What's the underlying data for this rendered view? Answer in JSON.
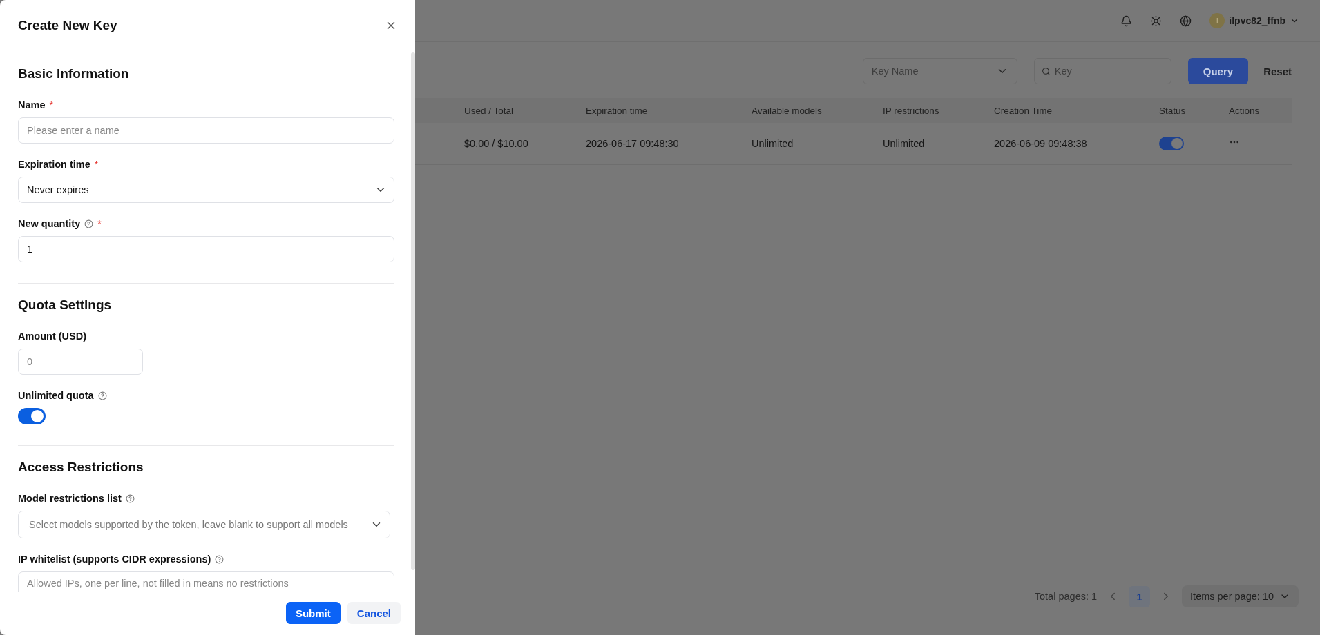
{
  "drawer": {
    "title": "Create New Key",
    "sections": [
      {
        "title": "Basic Information",
        "fields": [
          {
            "kind": "text",
            "label": "Name",
            "required_mark": "*",
            "placeholder": "Please enter a name"
          },
          {
            "kind": "select",
            "label": "Expiration time",
            "required_mark": "*",
            "value": "Never expires"
          },
          {
            "kind": "text",
            "label": "New quantity",
            "required_mark": "*",
            "help": true,
            "value": "1"
          }
        ]
      },
      {
        "title": "Quota Settings",
        "fields": [
          {
            "kind": "number",
            "label": "Amount (USD)",
            "placeholder": "0"
          },
          {
            "kind": "switch",
            "label": "Unlimited quota",
            "help": true,
            "on": true
          }
        ]
      },
      {
        "title": "Access Restrictions",
        "fields": [
          {
            "kind": "select",
            "label": "Model restrictions list",
            "help": true,
            "placeholder": "Select models supported by the token, leave blank to support all models"
          },
          {
            "kind": "textarea",
            "label": "IP whitelist (supports CIDR expressions)",
            "help": true,
            "placeholder": "Allowed IPs, one per line, not filled in means no restrictions"
          }
        ]
      }
    ],
    "buttons": [
      {
        "label": "Submit",
        "kind": "primary"
      },
      {
        "label": "Cancel",
        "kind": "secondary"
      }
    ]
  },
  "topbar": {
    "avatar_initial": "I",
    "username": "ilpvc82_ffnb"
  },
  "filters": {
    "select_placeholder": "Key Name",
    "search_placeholder": "Key",
    "buttons": [
      {
        "label": "Query",
        "kind": "primary"
      },
      {
        "label": "Reset",
        "kind": "text"
      }
    ]
  },
  "table": {
    "columns": [
      "Used / Total",
      "Expiration time",
      "Available models",
      "IP restrictions",
      "Creation Time",
      "Status",
      "Actions"
    ],
    "rows": [
      {
        "cells": [
          "$0.00 / $10.00",
          "2026-06-17 09:48:30",
          "Unlimited",
          "Unlimited",
          "2026-06-09 09:48:38"
        ],
        "enabled": true
      }
    ]
  },
  "pagination": {
    "total": "Total pages: 1",
    "pages": [
      {
        "label": "1",
        "selected": true
      }
    ],
    "page_size": "Items per page: 10"
  }
}
